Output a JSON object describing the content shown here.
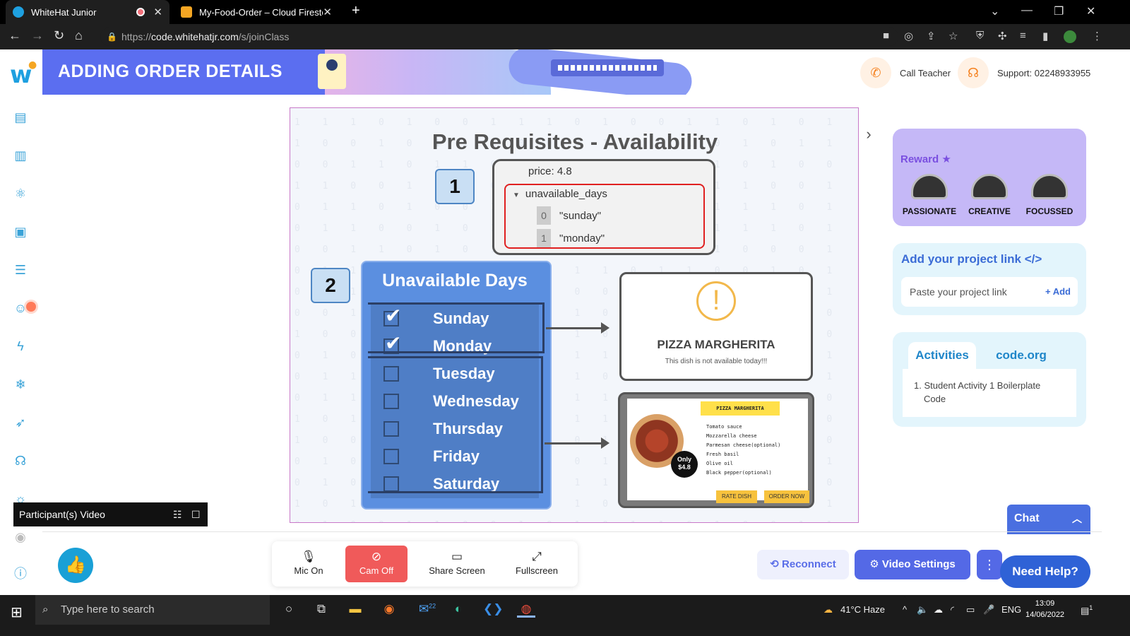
{
  "browser": {
    "tabs": [
      {
        "label": "WhiteHat Junior",
        "active": true
      },
      {
        "label": "My-Food-Order – Cloud Firestore",
        "active": false
      }
    ],
    "url_prefix": "https://",
    "url_host": "code.whitehatjr.com",
    "url_path": "/s/joinClass"
  },
  "header": {
    "title": "ADDING ORDER DETAILS",
    "call_teacher": "Call Teacher",
    "support": "Support: 02248933955"
  },
  "slide": {
    "title": "Pre Requisites - Availability",
    "step1": "1",
    "step2": "2",
    "firestore": {
      "price_label": "price:",
      "price_value": "4.8",
      "field_name": "unavailable_days",
      "items": [
        {
          "index": "0",
          "value": "\"sunday\""
        },
        {
          "index": "1",
          "value": "\"monday\""
        }
      ]
    },
    "unavailable_days": {
      "title": "Unavailable Days",
      "days": [
        {
          "label": "Sunday",
          "checked": true
        },
        {
          "label": "Monday",
          "checked": true
        },
        {
          "label": "Tuesday",
          "checked": false
        },
        {
          "label": "Wednesday",
          "checked": false
        },
        {
          "label": "Thursday",
          "checked": false
        },
        {
          "label": "Friday",
          "checked": false
        },
        {
          "label": "Saturday",
          "checked": false
        }
      ]
    },
    "dish_card": {
      "name": "PIZZA MARGHERITA",
      "message": "This dish is not available today!!!"
    },
    "menu_card": {
      "title": "PIZZA MARGHERITA",
      "ingredients": [
        "Tomato sauce",
        "Mozzarella cheese",
        "Parmesan cheese(optional)",
        "Fresh basil",
        "Olive oil",
        "Black pepper(optional)"
      ],
      "price_badge_line1": "Only",
      "price_badge_line2": "$4.8",
      "rate_button": "RATE DISH",
      "order_button": "ORDER NOW"
    }
  },
  "right_panel": {
    "reward_label": "Reward",
    "badges": [
      "PASSIONATE",
      "CREATIVE",
      "FOCUSSED"
    ],
    "project_title": "Add your project link </>",
    "project_placeholder": "Paste your project link",
    "project_add": "+ Add",
    "tabs": [
      "Activities",
      "code.org"
    ],
    "activity_items": [
      "1.  Student Activity 1 Boilerplate Code"
    ]
  },
  "chat": {
    "label": "Chat"
  },
  "participant_video": {
    "label": "Participant(s) Video"
  },
  "controls": {
    "mic": "Mic On",
    "cam": "Cam Off",
    "share": "Share Screen",
    "fullscreen": "Fullscreen",
    "reconnect": "Reconnect",
    "video_settings": "Video Settings",
    "need_help": "Need Help?"
  },
  "taskbar": {
    "search_placeholder": "Type here to search",
    "mail_badge": "22",
    "weather": "41°C  Haze",
    "lang": "ENG",
    "time": "13:09",
    "date": "14/06/2022",
    "notif_count": "1"
  },
  "colors": {
    "accent": "#5b6ef0",
    "panel_blue": "#5b8fe0",
    "reward_bg": "#c5b8f7",
    "warning": "#f2b84b",
    "danger": "#e02020"
  }
}
